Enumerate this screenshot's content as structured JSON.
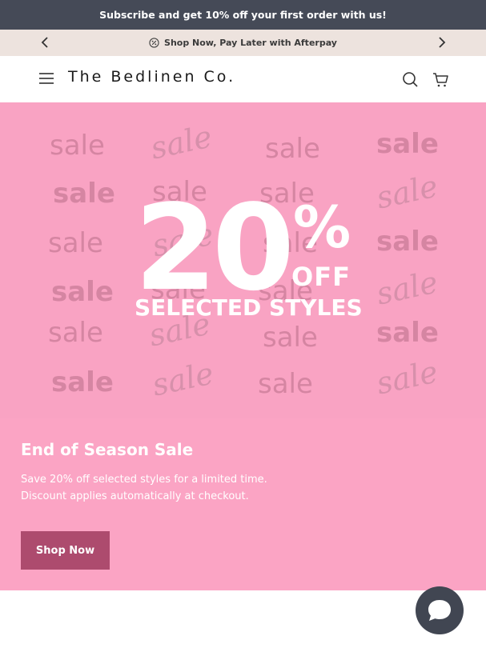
{
  "announcement": {
    "text": "Subscribe and get 10% off your first order with us!"
  },
  "promo": {
    "text": "Shop Now, Pay Later with Afterpay",
    "icon": "afterpay-badge-icon",
    "prev_icon": "chevron-left-icon",
    "next_icon": "chevron-right-icon"
  },
  "header": {
    "logo": "The Bedlinen Co.",
    "menu_icon": "hamburger-menu-icon",
    "search_icon": "search-icon",
    "cart_icon": "cart-icon"
  },
  "banner": {
    "big_number": "20",
    "percent": "%",
    "off": "OFF",
    "subline": "SELECTED STYLES",
    "background_words": [
      "sale",
      "sale",
      "sale",
      "sale",
      "sale",
      "sale",
      "sale",
      "sale",
      "sale",
      "sale",
      "sale",
      "sale",
      "sale",
      "sale",
      "sale",
      "sale",
      "sale",
      "sale",
      "sale",
      "sale",
      "sale",
      "sale",
      "sale",
      "sale"
    ]
  },
  "hero": {
    "title": "End of Season Sale",
    "description_line1": "Save 20% off selected styles for a limited time.",
    "description_line2": "Discount applies automatically at checkout.",
    "button_label": "Shop Now"
  },
  "chat": {
    "icon": "chat-bubble-icon"
  },
  "colors": {
    "topbar": "#454a57",
    "promobar": "#ede3de",
    "hero_bg": "#fba4c4",
    "button": "#ad4b6e",
    "chat": "#414652"
  }
}
